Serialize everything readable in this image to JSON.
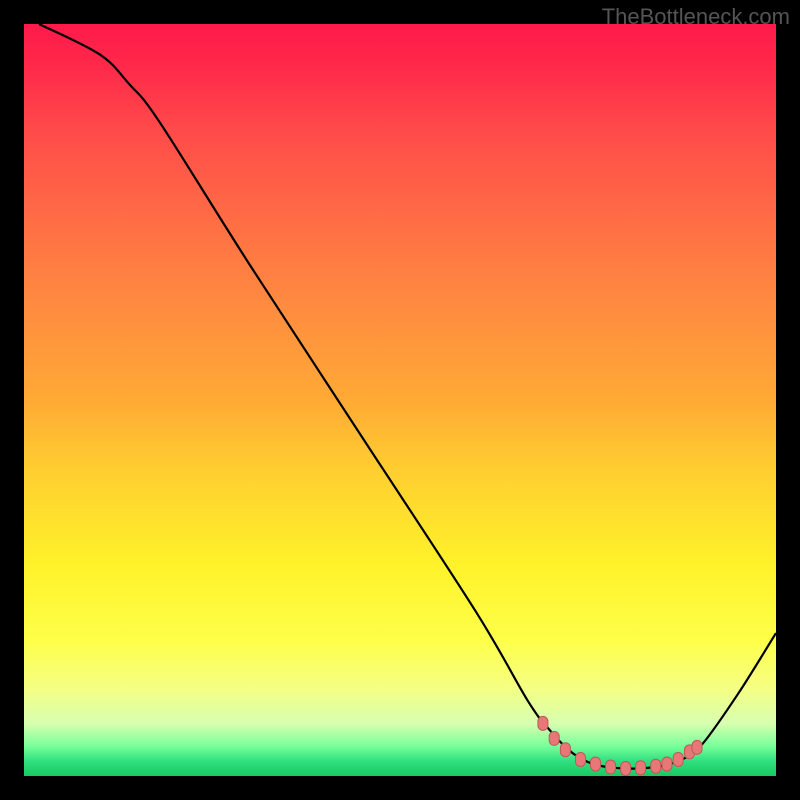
{
  "watermark": "TheBottleneck.com",
  "chart_data": {
    "type": "line",
    "title": "",
    "xlabel": "",
    "ylabel": "",
    "xlim": [
      0,
      100
    ],
    "ylim": [
      0,
      100
    ],
    "curve": {
      "points": [
        {
          "x": 2,
          "y": 100
        },
        {
          "x": 10,
          "y": 96
        },
        {
          "x": 14,
          "y": 92
        },
        {
          "x": 18,
          "y": 87
        },
        {
          "x": 30,
          "y": 68
        },
        {
          "x": 45,
          "y": 45
        },
        {
          "x": 60,
          "y": 22
        },
        {
          "x": 67,
          "y": 10
        },
        {
          "x": 70,
          "y": 6
        },
        {
          "x": 73,
          "y": 3
        },
        {
          "x": 76,
          "y": 1.5
        },
        {
          "x": 80,
          "y": 1
        },
        {
          "x": 84,
          "y": 1.2
        },
        {
          "x": 87,
          "y": 2
        },
        {
          "x": 90,
          "y": 4
        },
        {
          "x": 95,
          "y": 11
        },
        {
          "x": 100,
          "y": 19
        }
      ]
    },
    "markers": [
      {
        "x": 69,
        "y": 7
      },
      {
        "x": 70.5,
        "y": 5
      },
      {
        "x": 72,
        "y": 3.5
      },
      {
        "x": 74,
        "y": 2.2
      },
      {
        "x": 76,
        "y": 1.6
      },
      {
        "x": 78,
        "y": 1.2
      },
      {
        "x": 80,
        "y": 1.0
      },
      {
        "x": 82,
        "y": 1.1
      },
      {
        "x": 84,
        "y": 1.3
      },
      {
        "x": 85.5,
        "y": 1.6
      },
      {
        "x": 87,
        "y": 2.2
      },
      {
        "x": 88.5,
        "y": 3.2
      },
      {
        "x": 89.5,
        "y": 3.8
      }
    ],
    "marker_style": {
      "shape": "rounded-bar",
      "fill": "#e87878",
      "stroke": "#c05858"
    },
    "line_style": {
      "stroke": "#000000",
      "width": 2.2
    }
  }
}
